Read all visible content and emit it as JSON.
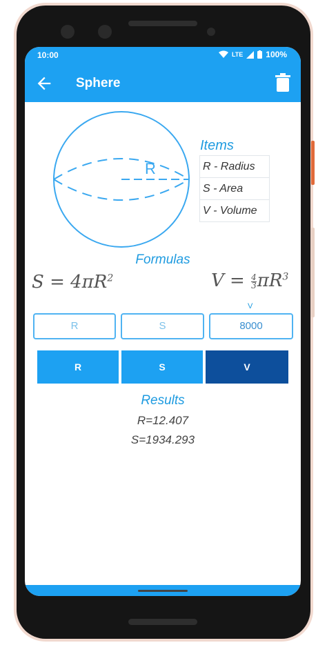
{
  "status_bar": {
    "time": "10:00",
    "network": "LTE",
    "battery": "100%"
  },
  "app_bar": {
    "title": "Sphere",
    "back_icon": "arrow-left-icon",
    "delete_icon": "trash-icon"
  },
  "diagram": {
    "radius_label": "R"
  },
  "items": {
    "title": "Items",
    "rows": [
      "R - Radius",
      "S - Area",
      "V - Volume"
    ]
  },
  "formulas": {
    "title": "Formulas",
    "area": {
      "lhs": "S",
      "body": "= 4πR",
      "exp": "2"
    },
    "volume": {
      "lhs": "V",
      "eq": "=",
      "num": "4",
      "den": "3",
      "body": "πR",
      "exp": "3"
    }
  },
  "inputs": {
    "r": {
      "placeholder": "R",
      "value": ""
    },
    "s": {
      "placeholder": "S",
      "value": ""
    },
    "v": {
      "label": "V",
      "placeholder": "V",
      "value": "8000"
    }
  },
  "buttons": {
    "r": "R",
    "s": "S",
    "v": "V"
  },
  "results": {
    "title": "Results",
    "lines": [
      "R=12.407",
      "S=1934.293"
    ]
  },
  "colors": {
    "primary": "#1da1f2",
    "selected_button": "#0d4f9c",
    "accent_text": "#1e9be0"
  }
}
